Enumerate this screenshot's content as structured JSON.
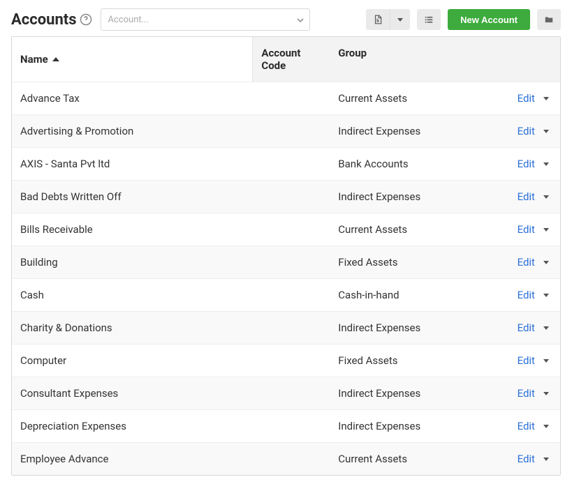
{
  "header": {
    "title": "Accounts",
    "search_placeholder": "Account...",
    "new_button_label": "New Account"
  },
  "table": {
    "columns": {
      "name": "Name",
      "code": "Account Code",
      "group": "Group"
    },
    "edit_label": "Edit",
    "rows": [
      {
        "name": "Advance Tax",
        "code": "",
        "group": "Current Assets"
      },
      {
        "name": "Advertising & Promotion",
        "code": "",
        "group": "Indirect Expenses"
      },
      {
        "name": "AXIS - Santa Pvt ltd",
        "code": "",
        "group": "Bank Accounts"
      },
      {
        "name": "Bad Debts Written Off",
        "code": "",
        "group": "Indirect Expenses"
      },
      {
        "name": "Bills Receivable",
        "code": "",
        "group": "Current Assets"
      },
      {
        "name": "Building",
        "code": "",
        "group": "Fixed Assets"
      },
      {
        "name": "Cash",
        "code": "",
        "group": "Cash-in-hand"
      },
      {
        "name": "Charity & Donations",
        "code": "",
        "group": "Indirect Expenses"
      },
      {
        "name": "Computer",
        "code": "",
        "group": "Fixed Assets"
      },
      {
        "name": "Consultant Expenses",
        "code": "",
        "group": "Indirect Expenses"
      },
      {
        "name": "Depreciation Expenses",
        "code": "",
        "group": "Indirect Expenses"
      },
      {
        "name": "Employee Advance",
        "code": "",
        "group": "Current Assets"
      }
    ]
  }
}
